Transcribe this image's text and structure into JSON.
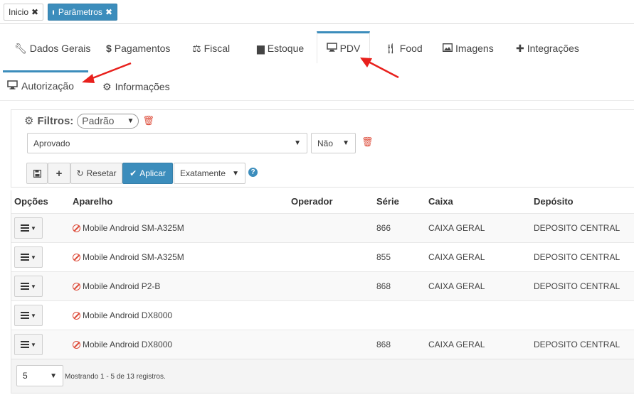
{
  "doc_tabs": {
    "home_label": "Inicio",
    "params_label": "Parâmetros"
  },
  "nav_tabs": [
    "Dados Gerais",
    "Pagamentos",
    "Fiscal",
    "Estoque",
    "PDV",
    "Food",
    "Imagens",
    "Integrações"
  ],
  "sub_tabs": [
    "Autorização",
    "Informações"
  ],
  "filters": {
    "legend": "Filtros:",
    "preset": "Padrão",
    "status_value": "Aprovado",
    "bool_value": "Não",
    "reset_label": "Resetar",
    "apply_label": "Aplicar",
    "match_value": "Exatamente"
  },
  "table": {
    "headers": [
      "Opções",
      "Aparelho",
      "Operador",
      "Série",
      "Caixa",
      "Depósito"
    ],
    "rows": [
      {
        "aparelho": "Mobile Android SM-A325M",
        "operador": "",
        "serie": "866",
        "caixa": "CAIXA GERAL",
        "deposito": "DEPOSITO CENTRAL"
      },
      {
        "aparelho": "Mobile Android SM-A325M",
        "operador": "",
        "serie": "855",
        "caixa": "CAIXA GERAL",
        "deposito": "DEPOSITO CENTRAL"
      },
      {
        "aparelho": "Mobile Android P2-B",
        "operador": "",
        "serie": "868",
        "caixa": "CAIXA GERAL",
        "deposito": "DEPOSITO CENTRAL"
      },
      {
        "aparelho": "Mobile Android DX8000",
        "operador": "",
        "serie": "",
        "caixa": "",
        "deposito": ""
      },
      {
        "aparelho": "Mobile Android DX8000",
        "operador": "",
        "serie": "868",
        "caixa": "CAIXA GERAL",
        "deposito": "DEPOSITO CENTRAL"
      }
    ]
  },
  "footer": {
    "page_size": "5",
    "summary": "Mostrando 1 - 5 de 13 registros."
  },
  "colors": {
    "accent": "#3c8dbc",
    "danger": "#dd4b39",
    "annotation": "#e8201c"
  }
}
